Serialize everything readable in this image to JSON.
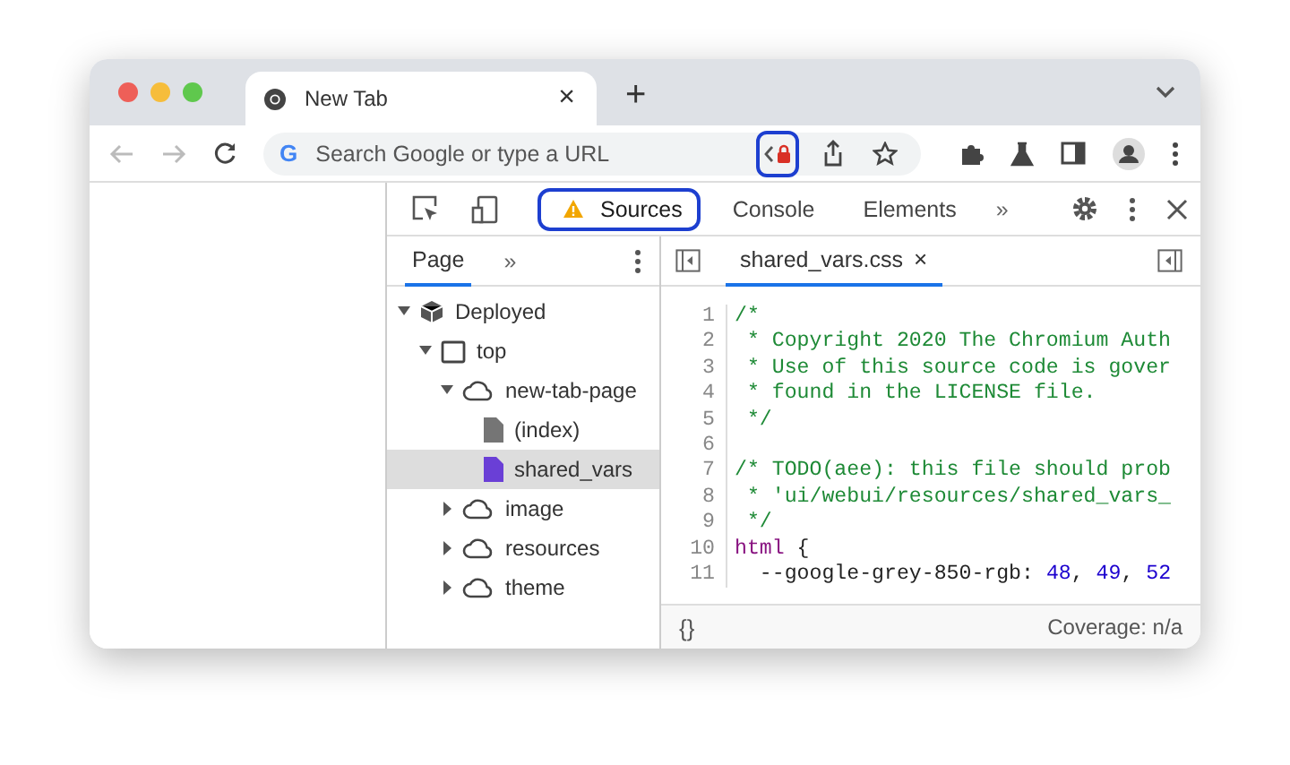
{
  "browser_tab": {
    "title": "New Tab",
    "close": "×",
    "new_tab": "+"
  },
  "omnibox": {
    "placeholder": "Search Google or type a URL",
    "google_mark": "G"
  },
  "toolbar_icons": [
    {
      "kind": "code",
      "highlighted": true
    },
    {
      "kind": "share",
      "highlighted": false
    },
    {
      "kind": "star",
      "highlighted": false
    }
  ],
  "devtools": {
    "tabs": [
      {
        "label": "Sources",
        "selected": true,
        "warning": true,
        "highlighted": true
      },
      {
        "label": "Console",
        "selected": false,
        "warning": false,
        "highlighted": false
      },
      {
        "label": "Elements",
        "selected": false,
        "warning": false,
        "highlighted": false
      }
    ],
    "more_tabs": "»",
    "navigator": {
      "tab": {
        "label": "Page",
        "selected": true
      },
      "more": "»",
      "tree": [
        {
          "label": "Deployed",
          "kind": "deployed",
          "expanded": true,
          "selected": false,
          "children": [
            {
              "label": "top",
              "kind": "frame",
              "expanded": true,
              "selected": false,
              "children": [
                {
                  "label": "new-tab-page",
                  "kind": "domain",
                  "expanded": true,
                  "selected": false,
                  "children": [
                    {
                      "label": "(index)",
                      "kind": "file",
                      "color": "#757575",
                      "selected": false
                    },
                    {
                      "label": "shared_vars",
                      "kind": "file",
                      "color": "#6a3fd6",
                      "selected": true
                    }
                  ]
                },
                {
                  "label": "image",
                  "kind": "domain",
                  "expanded": false,
                  "selected": false
                },
                {
                  "label": "resources",
                  "kind": "domain",
                  "expanded": false,
                  "selected": false
                },
                {
                  "label": "theme",
                  "kind": "domain",
                  "expanded": false,
                  "selected": false
                }
              ]
            }
          ]
        }
      ]
    },
    "editor": {
      "file_tab": {
        "label": "shared_vars.css",
        "close": "×",
        "selected": true
      },
      "lines": [
        {
          "number": "1",
          "tokens": [
            {
              "text": "/*",
              "kind": "comment"
            }
          ]
        },
        {
          "number": "2",
          "tokens": [
            {
              "text": " * Copyright 2020 The Chromium Auth",
              "kind": "comment"
            }
          ]
        },
        {
          "number": "3",
          "tokens": [
            {
              "text": " * Use of this source code is gover",
              "kind": "comment"
            }
          ]
        },
        {
          "number": "4",
          "tokens": [
            {
              "text": " * found in the LICENSE file.",
              "kind": "comment"
            }
          ]
        },
        {
          "number": "5",
          "tokens": [
            {
              "text": " */",
              "kind": "comment"
            }
          ]
        },
        {
          "number": "6"
        },
        {
          "number": "7",
          "tokens": [
            {
              "text": "/* TODO(aee): this file should prob",
              "kind": "comment"
            }
          ]
        },
        {
          "number": "8",
          "tokens": [
            {
              "text": " * 'ui/webui/resources/shared_vars_",
              "kind": "comment"
            }
          ]
        },
        {
          "number": "9",
          "tokens": [
            {
              "text": " */",
              "kind": "comment"
            }
          ]
        },
        {
          "number": "10",
          "tokens": [
            {
              "text": "html",
              "kind": "selector"
            },
            {
              "text": " {",
              "kind": "plain"
            }
          ]
        },
        {
          "number": "11",
          "tokens": [
            {
              "text": "  --google-grey-850-rgb: ",
              "kind": "plain"
            },
            {
              "text": "48",
              "kind": "number"
            },
            {
              "text": ", ",
              "kind": "plain"
            },
            {
              "text": "49",
              "kind": "number"
            },
            {
              "text": ", ",
              "kind": "plain"
            },
            {
              "text": "52",
              "kind": "number"
            }
          ]
        }
      ],
      "format_button": "{}",
      "coverage": "Coverage: n/a"
    }
  }
}
